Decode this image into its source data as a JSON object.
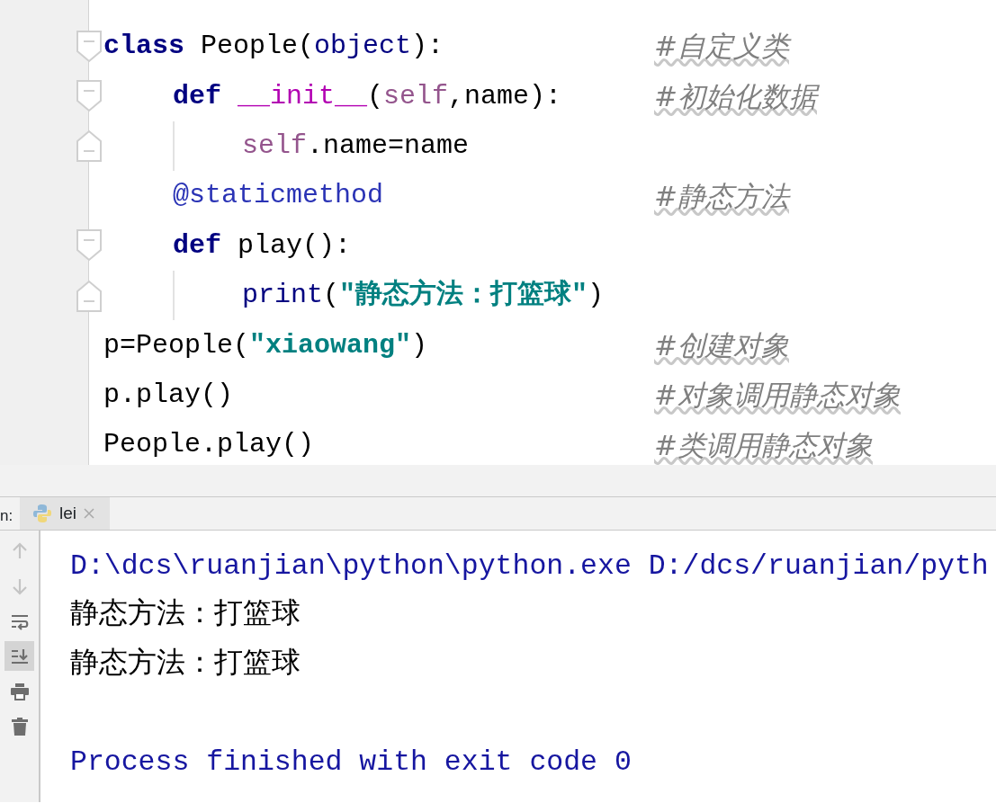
{
  "editor": {
    "lines": [
      {
        "fold_start": true,
        "fold_end": false,
        "tokens": [
          {
            "kind": "keyword",
            "text": "class"
          },
          {
            "kind": "plain",
            "text": " People("
          },
          {
            "kind": "builtin",
            "text": "object"
          },
          {
            "kind": "plain",
            "text": "):"
          }
        ],
        "comment": "#自定义类",
        "children": [
          {
            "fold_start": true,
            "fold_end": false,
            "tokens": [
              {
                "kind": "keyword",
                "text": "def "
              },
              {
                "kind": "magic",
                "text": "__init__"
              },
              {
                "kind": "plain",
                "text": "("
              },
              {
                "kind": "self",
                "text": "self"
              },
              {
                "kind": "plain",
                "text": ",name):"
              }
            ],
            "comment": "#初始化数据",
            "children": [
              {
                "fold_start": false,
                "fold_end": true,
                "tokens": [
                  {
                    "kind": "self",
                    "text": "self"
                  },
                  {
                    "kind": "plain",
                    "text": ".name=name"
                  }
                ]
              }
            ]
          },
          {
            "fold_start": false,
            "fold_end": false,
            "tokens": [
              {
                "kind": "decorator",
                "text": "@staticmethod"
              }
            ],
            "comment": "#静态方法"
          },
          {
            "fold_start": true,
            "fold_end": false,
            "tokens": [
              {
                "kind": "keyword",
                "text": "def"
              },
              {
                "kind": "plain",
                "text": " play():"
              }
            ],
            "children": [
              {
                "fold_start": false,
                "fold_end": true,
                "tokens": [
                  {
                    "kind": "builtin",
                    "text": "print"
                  },
                  {
                    "kind": "plain",
                    "text": "("
                  },
                  {
                    "kind": "string",
                    "text": "\"静态方法：打篮球\""
                  },
                  {
                    "kind": "plain",
                    "text": ")"
                  }
                ]
              }
            ]
          }
        ]
      },
      {
        "fold_start": false,
        "fold_end": false,
        "tokens": [
          {
            "kind": "plain",
            "text": "p=People("
          },
          {
            "kind": "string",
            "text": "\"xiaowang\""
          },
          {
            "kind": "plain",
            "text": ")"
          }
        ],
        "comment": "#创建对象"
      },
      {
        "fold_start": false,
        "fold_end": false,
        "tokens": [
          {
            "kind": "plain",
            "text": "p.play()"
          }
        ],
        "comment": "#对象调用静态对象"
      },
      {
        "fold_start": false,
        "fold_end": false,
        "tokens": [
          {
            "kind": "plain",
            "text": "People.play()"
          }
        ],
        "comment": "#类调用静态对象"
      }
    ]
  },
  "run_panel": {
    "label": "n:",
    "tabs": [
      {
        "label": "lei",
        "selected": true
      }
    ],
    "tools": [
      {
        "kind": "up",
        "disabled": true,
        "on": false
      },
      {
        "kind": "down",
        "disabled": true,
        "on": false
      },
      {
        "kind": "wrap",
        "disabled": false,
        "on": false
      },
      {
        "kind": "scroll-end",
        "disabled": false,
        "on": true
      },
      {
        "kind": "print",
        "disabled": false,
        "on": false
      },
      {
        "kind": "trash",
        "disabled": false,
        "on": false
      }
    ],
    "console": [
      {
        "kind": "system",
        "text": "D:\\dcs\\ruanjian\\python\\python.exe D:/dcs/ruanjian/pyth"
      },
      {
        "kind": "output",
        "text": "静态方法：打篮球"
      },
      {
        "kind": "output",
        "text": "静态方法：打篮球"
      },
      {
        "kind": "blank"
      },
      {
        "kind": "system",
        "text": "Process finished with exit code 0"
      }
    ]
  }
}
